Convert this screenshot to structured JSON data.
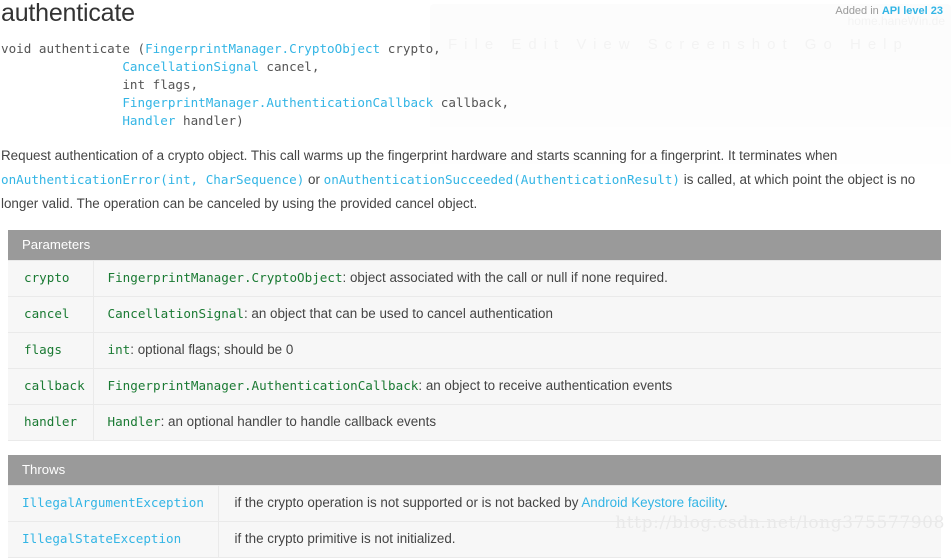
{
  "header": {
    "title": "authenticate",
    "added_prefix": "Added in ",
    "api_level_link": "API level 23"
  },
  "signature": {
    "lines": [
      [
        {
          "text": "void authenticate (",
          "kind": "plain"
        },
        {
          "text": "FingerprintManager.CryptoObject",
          "kind": "type"
        },
        {
          "text": " crypto,",
          "kind": "plain"
        }
      ],
      [
        {
          "text": "                ",
          "kind": "plain"
        },
        {
          "text": "CancellationSignal",
          "kind": "type"
        },
        {
          "text": " cancel,",
          "kind": "plain"
        }
      ],
      [
        {
          "text": "                int flags,",
          "kind": "plain"
        }
      ],
      [
        {
          "text": "                ",
          "kind": "plain"
        },
        {
          "text": "FingerprintManager.AuthenticationCallback",
          "kind": "type"
        },
        {
          "text": " callback,",
          "kind": "plain"
        }
      ],
      [
        {
          "text": "                ",
          "kind": "plain"
        },
        {
          "text": "Handler",
          "kind": "type"
        },
        {
          "text": " handler)",
          "kind": "plain"
        }
      ]
    ]
  },
  "description": {
    "part1": "Request authentication of a crypto object. This call warms up the fingerprint hardware and starts scanning for a fingerprint. It terminates when ",
    "link1": "onAuthenticationError(int, CharSequence)",
    "part2": " or ",
    "link2": "onAuthenticationSucceeded(AuthenticationResult)",
    "part3": " is called, at which point the object is no longer valid. The operation can be canceled by using the provided cancel object."
  },
  "parameters": {
    "title": "Parameters",
    "rows": [
      {
        "name": "crypto",
        "type": "FingerprintManager.CryptoObject",
        "desc": ": object associated with the call or null if none required."
      },
      {
        "name": "cancel",
        "type": "CancellationSignal",
        "desc": ": an object that can be used to cancel authentication"
      },
      {
        "name": "flags",
        "type": "int",
        "desc": ": optional flags; should be 0"
      },
      {
        "name": "callback",
        "type": "FingerprintManager.AuthenticationCallback",
        "desc": ": an object to receive authentication events"
      },
      {
        "name": "handler",
        "type": "Handler",
        "desc": ": an optional handler to handle callback events"
      }
    ]
  },
  "throws": {
    "title": "Throws",
    "rows": [
      {
        "exception": "IllegalArgumentException",
        "desc_before": "if the crypto operation is not supported or is not backed by ",
        "desc_link": "Android Keystore facility",
        "desc_after": "."
      },
      {
        "exception": "IllegalStateException",
        "desc_before": "if the crypto primitive is not initialized.",
        "desc_link": "",
        "desc_after": ""
      }
    ]
  },
  "watermark": {
    "url": "http://blog.csdn.net/long375577908",
    "ghost_menu": "File   Edit   View   Screenshot   Go   Help",
    "ghost_right": "home.haneWin.de"
  },
  "colors": {
    "link": "#33b5e5",
    "code_green": "#1a7a33",
    "table_header": "#9a9a9a",
    "table_bg": "#f7f7f7",
    "text": "#444444"
  }
}
